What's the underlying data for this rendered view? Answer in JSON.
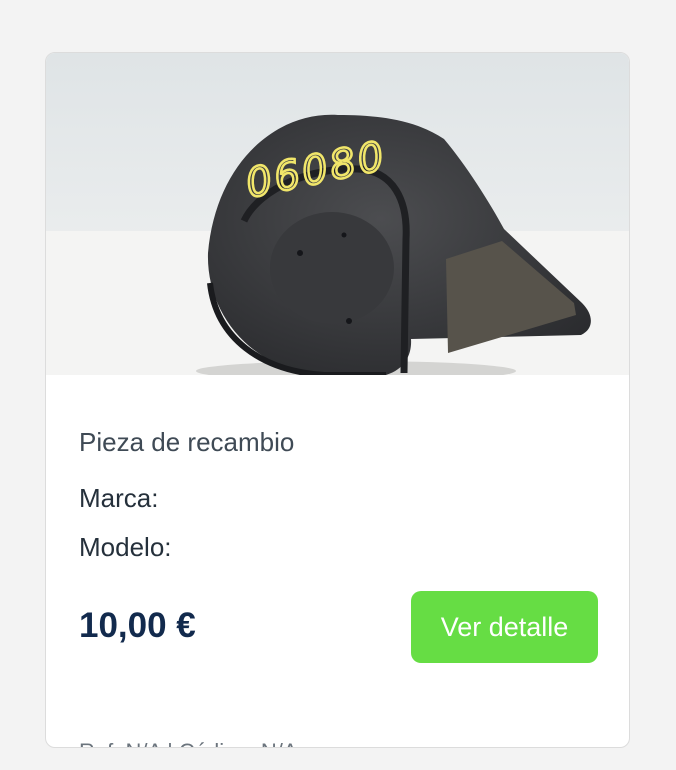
{
  "product": {
    "type_label": "Pieza de recambio",
    "brand_label": "Marca:",
    "model_label": "Modelo:",
    "price": "10,00 €",
    "detail_button": "Ver detalle",
    "ref_label": "Ref:",
    "ref_value": "N/A",
    "separator": "|",
    "code_label": "Código:",
    "code_value": "N/A",
    "image_marking": "06080"
  },
  "colors": {
    "button": "#66dd44",
    "price": "#122a4d"
  }
}
